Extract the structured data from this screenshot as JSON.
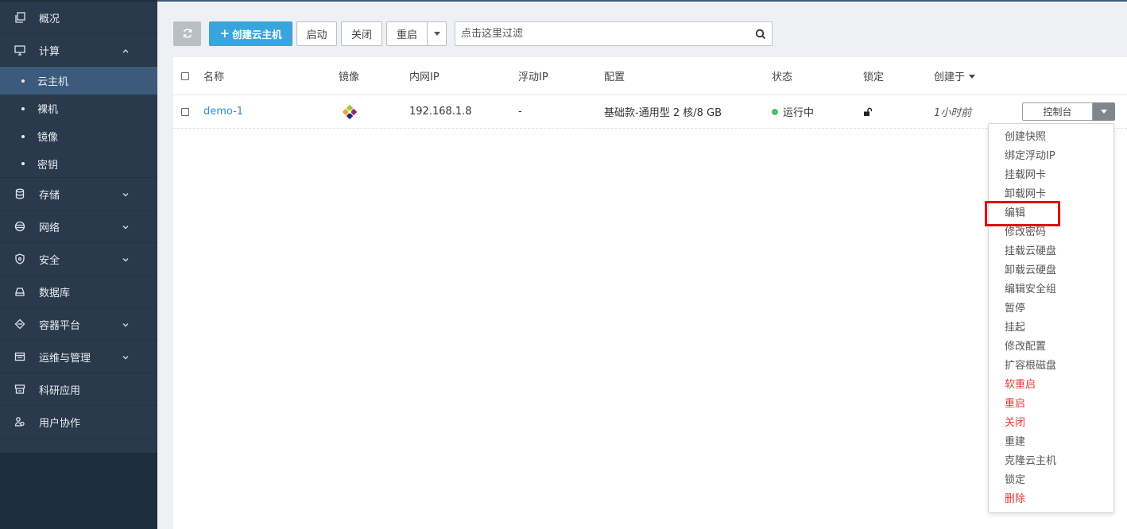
{
  "sidebar": {
    "items": [
      {
        "label": "概况",
        "icon": "dashboard-icon"
      },
      {
        "label": "计算",
        "icon": "monitor-icon",
        "expanded": true
      },
      {
        "label": "存储",
        "icon": "database-icon"
      },
      {
        "label": "网络",
        "icon": "network-icon"
      },
      {
        "label": "安全",
        "icon": "shield-icon"
      },
      {
        "label": "数据库",
        "icon": "db-server-icon"
      },
      {
        "label": "容器平台",
        "icon": "container-icon"
      },
      {
        "label": "运维与管理",
        "icon": "ops-icon"
      },
      {
        "label": "科研应用",
        "icon": "store-icon"
      },
      {
        "label": "用户协作",
        "icon": "users-icon"
      }
    ],
    "compute_sub": [
      {
        "label": "云主机",
        "active": true
      },
      {
        "label": "裸机"
      },
      {
        "label": "镜像"
      },
      {
        "label": "密钥"
      }
    ]
  },
  "toolbar": {
    "create_label": "创建云主机",
    "start_label": "启动",
    "close_label": "关闭",
    "restart_label": "重启",
    "search_placeholder": "点击这里过滤"
  },
  "table": {
    "headers": {
      "name": "名称",
      "image": "镜像",
      "ip": "内网IP",
      "floating_ip": "浮动IP",
      "config": "配置",
      "status": "状态",
      "lock": "锁定",
      "created": "创建于"
    },
    "rows": [
      {
        "name": "demo-1",
        "ip": "192.168.1.8",
        "floating_ip": "-",
        "config": "基础款-通用型 2 核/8 GB",
        "status": "运行中",
        "created": "1小时前",
        "console_label": "控制台"
      }
    ]
  },
  "actions_menu": [
    {
      "label": "创建快照"
    },
    {
      "label": "绑定浮动IP"
    },
    {
      "label": "挂载网卡"
    },
    {
      "label": "卸载网卡"
    },
    {
      "label": "编辑",
      "highlighted": true
    },
    {
      "label": "修改密码"
    },
    {
      "label": "挂载云硬盘"
    },
    {
      "label": "卸载云硬盘"
    },
    {
      "label": "编辑安全组"
    },
    {
      "label": "暂停"
    },
    {
      "label": "挂起"
    },
    {
      "label": "修改配置"
    },
    {
      "label": "扩容根磁盘"
    },
    {
      "label": "软重启",
      "danger": true
    },
    {
      "label": "重启",
      "danger": true
    },
    {
      "label": "关闭",
      "danger": true
    },
    {
      "label": "重建"
    },
    {
      "label": "克隆云主机"
    },
    {
      "label": "锁定"
    },
    {
      "label": "删除",
      "danger": true
    }
  ],
  "colors": {
    "sidebar_bg": "#2a3a4c",
    "active_sub": "#3c5a7c",
    "primary": "#3aa5dc",
    "link": "#2a8fd0",
    "running": "#4cc26a",
    "danger": "#e53935",
    "highlight": "#e01010"
  }
}
